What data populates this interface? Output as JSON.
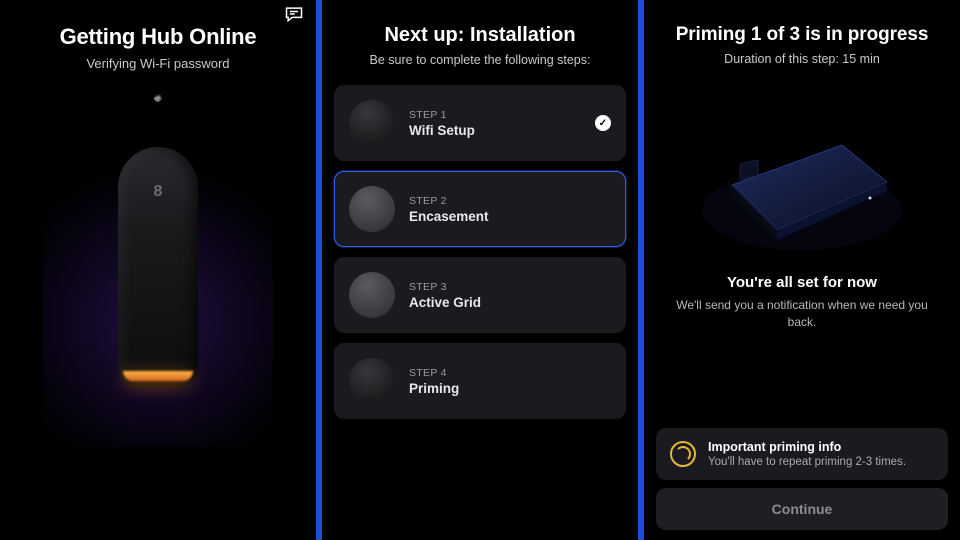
{
  "pane1": {
    "title": "Getting Hub Online",
    "subtitle": "Verifying Wi-Fi password",
    "hub_logo": "8"
  },
  "pane2": {
    "title": "Next up: Installation",
    "subtitle": "Be sure to complete the following steps:",
    "steps": [
      {
        "step_label": "STEP 1",
        "name": "Wifi Setup",
        "completed": true,
        "active": false
      },
      {
        "step_label": "STEP 2",
        "name": "Encasement",
        "completed": false,
        "active": true
      },
      {
        "step_label": "STEP 3",
        "name": "Active Grid",
        "completed": false,
        "active": false
      },
      {
        "step_label": "STEP 4",
        "name": "Priming",
        "completed": false,
        "active": false
      }
    ]
  },
  "pane3": {
    "title": "Priming 1 of 3 is in progress",
    "subtitle": "Duration of this step: 15 min",
    "ready_title": "You're all set for now",
    "ready_sub": "We'll send you a notification when we need you back.",
    "info_title": "Important priming info",
    "info_body": "You'll have to repeat priming 2-3 times.",
    "continue_label": "Continue"
  },
  "colors": {
    "accent_blue": "#2f5de8",
    "divider_blue": "#1a4dd8",
    "amber": "#e6b63a"
  }
}
